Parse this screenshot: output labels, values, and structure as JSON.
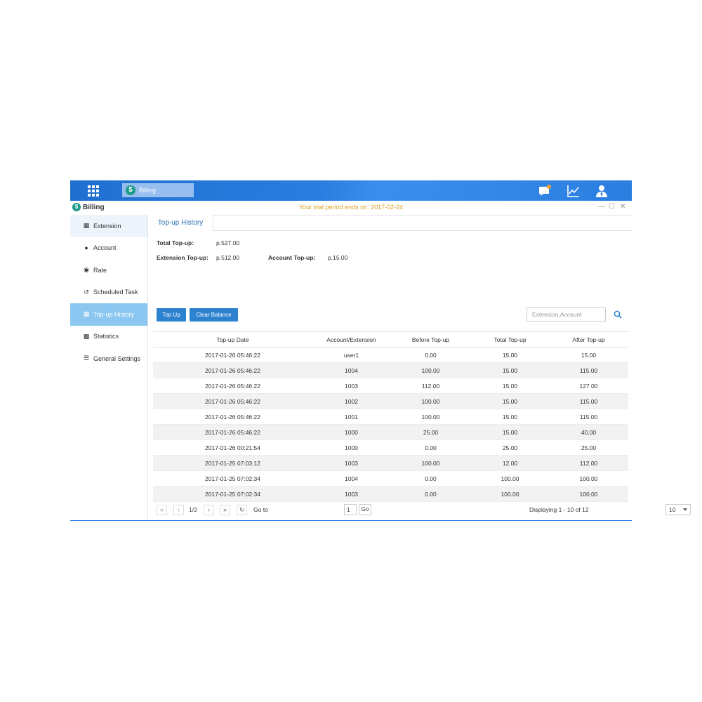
{
  "app": {
    "task_button_label": "Billing",
    "window_title": "Billing",
    "trial_notice": "Your trial period ends on: 2017-02-24"
  },
  "sidebar": {
    "items": [
      {
        "label": "Extension",
        "icon": "extension-icon"
      },
      {
        "label": "Account",
        "icon": "user-icon"
      },
      {
        "label": "Rate",
        "icon": "coin-icon"
      },
      {
        "label": "Scheduled Task",
        "icon": "history-clock-icon"
      },
      {
        "label": "Top-up History",
        "icon": "calendar-icon",
        "active": true
      },
      {
        "label": "Statistics",
        "icon": "bar-chart-icon"
      },
      {
        "label": "General Settings",
        "icon": "menu-lines-icon"
      }
    ]
  },
  "tab": {
    "label": "Top-up History"
  },
  "summary": {
    "total_label": "Total Top-up:",
    "total_value": "p.527.00",
    "extension_label": "Extension Top-up:",
    "extension_value": "p.512.00",
    "account_label": "Account Top-up:",
    "account_value": "p.15.00"
  },
  "actions": {
    "top_up": "Top Up",
    "clear_balance": "Clear Balance",
    "search_placeholder": "Extension,Account"
  },
  "table": {
    "headers": [
      "Top-up Date",
      "Account/Extension",
      "Before Top-up",
      "Total Top-up",
      "After Top-up"
    ],
    "rows": [
      [
        "2017-01-26 05:46:22",
        "user1",
        "0.00",
        "15.00",
        "15.00"
      ],
      [
        "2017-01-26 05:46:22",
        "1004",
        "100.00",
        "15.00",
        "115.00"
      ],
      [
        "2017-01-26 05:46:22",
        "1003",
        "112.00",
        "15.00",
        "127.00"
      ],
      [
        "2017-01-26 05:46:22",
        "1002",
        "100.00",
        "15.00",
        "115.00"
      ],
      [
        "2017-01-26 05:46:22",
        "1001",
        "100.00",
        "15.00",
        "115.00"
      ],
      [
        "2017-01-26 05:46:22",
        "1000",
        "25.00",
        "15.00",
        "40.00"
      ],
      [
        "2017-01-26 00:21:54",
        "1000",
        "0.00",
        "25.00",
        "25.00"
      ],
      [
        "2017-01-25 07:03:12",
        "1003",
        "100.00",
        "12.00",
        "112.00"
      ],
      [
        "2017-01-25 07:02:34",
        "1004",
        "0.00",
        "100.00",
        "100.00"
      ],
      [
        "2017-01-25 07:02:34",
        "1003",
        "0.00",
        "100.00",
        "100.00"
      ]
    ]
  },
  "pager": {
    "page": "1/2",
    "goto_label": "Go to",
    "goto_value": "1",
    "go_button": "Go",
    "displaying": "Displaying 1 - 10 of 12",
    "page_size": "10"
  },
  "colors": {
    "topbar": "#2a7ee0",
    "accent_button": "#2d82d0",
    "active_sidebar": "#8bc7f0",
    "trial_text": "#e0a020"
  }
}
